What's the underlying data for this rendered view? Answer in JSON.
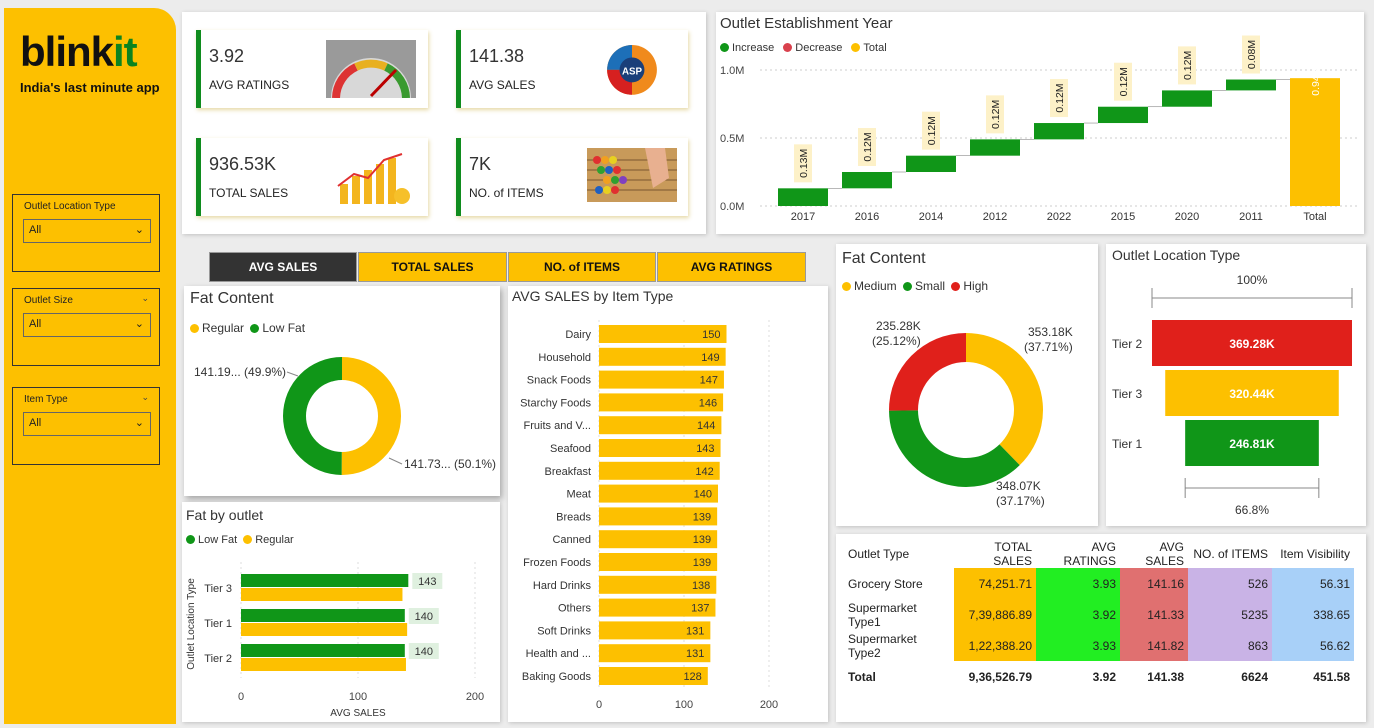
{
  "brand": {
    "name_main": "blink",
    "name_accent": "it",
    "tagline": "India's last minute app"
  },
  "slicers": [
    {
      "label": "Outlet Location Type",
      "value": "All"
    },
    {
      "label": "Outlet Size",
      "value": "All"
    },
    {
      "label": "Item Type",
      "value": "All"
    }
  ],
  "kpis": [
    {
      "value": "3.92",
      "label": "AVG RATINGS",
      "icon": "rating-gauge-image"
    },
    {
      "value": "141.38",
      "label": "AVG SALES",
      "icon": "asp-image"
    },
    {
      "value": "936.53K",
      "label": "TOTAL SALES",
      "icon": "coins-chart-image"
    },
    {
      "value": "7K",
      "label": "NO. of ITEMS",
      "icon": "abacus-image"
    }
  ],
  "tabs": [
    "AVG SALES",
    "TOTAL SALES",
    "NO. of ITEMS",
    "AVG RATINGS"
  ],
  "colors": {
    "yellow": "#fdc000",
    "green": "#109618",
    "red": "#e0201b",
    "dark": "#333333"
  },
  "waterfall": {
    "title": "Outlet Establishment Year",
    "legend": [
      "Increase",
      "Decrease",
      "Total"
    ],
    "y_ticks": [
      "1.0M",
      "0.5M",
      "0.0M"
    ]
  },
  "fat_content_small": {
    "title": "Fat Content",
    "legend": [
      "Regular",
      "Low Fat"
    ],
    "labels": [
      "141.19... (49.9%)",
      "141.73... (50.1%)"
    ]
  },
  "fat_by_outlet": {
    "title": "Fat by outlet",
    "legend": [
      "Low Fat",
      "Regular"
    ],
    "y_axis_title": "Outlet Location Type",
    "x_axis_title": "AVG SALES",
    "x_ticks": [
      "0",
      "100",
      "200"
    ]
  },
  "item_type": {
    "title": "AVG SALES by Item Type",
    "x_ticks": [
      "0",
      "100",
      "200"
    ]
  },
  "fat_content_large": {
    "title": "Fat Content",
    "legend": [
      "Medium",
      "Small",
      "High"
    ],
    "labels": {
      "high": [
        "235.28K",
        "(25.12%)"
      ],
      "medium": [
        "353.18K",
        "(37.71%)"
      ],
      "small": [
        "348.07K",
        "(37.17%)"
      ]
    }
  },
  "outlet_location": {
    "title": "Outlet Location Type",
    "top_pct": "100%",
    "bottom_pct": "66.8%"
  },
  "outlet_table": {
    "headers": [
      "Outlet Type",
      "TOTAL SALES",
      "AVG RATINGS",
      "AVG SALES",
      "NO. of ITEMS",
      "Item Visibility"
    ],
    "rows": [
      [
        "Grocery Store",
        "74,251.71",
        "3.93",
        "141.16",
        "526",
        "56.31"
      ],
      [
        "Supermarket Type1",
        "7,39,886.89",
        "3.92",
        "141.33",
        "5235",
        "338.65"
      ],
      [
        "Supermarket Type2",
        "1,22,388.20",
        "3.93",
        "141.82",
        "863",
        "56.62"
      ]
    ],
    "total": [
      "Total",
      "9,36,526.79",
      "3.92",
      "141.38",
      "6624",
      "451.58"
    ]
  },
  "chart_data": [
    {
      "type": "bar",
      "title": "Outlet Establishment Year",
      "subtype": "waterfall",
      "categories": [
        "2017",
        "2016",
        "2014",
        "2012",
        "2022",
        "2015",
        "2020",
        "2011",
        "Total"
      ],
      "values": [
        0.13,
        0.12,
        0.12,
        0.12,
        0.12,
        0.12,
        0.12,
        0.08,
        0.94
      ],
      "value_labels": [
        "0.13M",
        "0.12M",
        "0.12M",
        "0.12M",
        "0.12M",
        "0.12M",
        "0.12M",
        "0.08M",
        "0.94M"
      ],
      "ylim": [
        0,
        1.0
      ],
      "y_unit": "M"
    },
    {
      "type": "pie",
      "title": "Fat Content",
      "categories": [
        "Regular",
        "Low Fat"
      ],
      "values": [
        141.73,
        141.19
      ],
      "percent": [
        50.1,
        49.9
      ]
    },
    {
      "type": "bar",
      "title": "AVG SALES by Item Type",
      "orientation": "horizontal",
      "categories": [
        "Dairy",
        "Household",
        "Snack Foods",
        "Starchy Foods",
        "Fruits and V...",
        "Seafood",
        "Breakfast",
        "Meat",
        "Breads",
        "Canned",
        "Frozen Foods",
        "Hard Drinks",
        "Others",
        "Soft Drinks",
        "Health and ...",
        "Baking Goods"
      ],
      "values": [
        150,
        149,
        147,
        146,
        144,
        143,
        142,
        140,
        139,
        139,
        139,
        138,
        137,
        131,
        131,
        128
      ],
      "xlim": [
        0,
        200
      ]
    },
    {
      "type": "bar",
      "title": "Fat by outlet",
      "orientation": "horizontal",
      "categories": [
        "Tier 3",
        "Tier 1",
        "Tier 2"
      ],
      "series": [
        {
          "name": "Low Fat",
          "values": [
            143,
            140,
            140
          ]
        },
        {
          "name": "Regular",
          "values": [
            138,
            142,
            141
          ]
        }
      ],
      "xlabel": "AVG SALES",
      "ylabel": "Outlet Location Type",
      "xlim": [
        0,
        200
      ]
    },
    {
      "type": "pie",
      "title": "Fat Content",
      "categories": [
        "Medium",
        "Small",
        "High"
      ],
      "values": [
        353.18,
        348.07,
        235.28
      ],
      "percent": [
        37.71,
        37.17,
        25.12
      ]
    },
    {
      "type": "bar",
      "title": "Outlet Location Type",
      "subtype": "funnel",
      "categories": [
        "Tier 2",
        "Tier 3",
        "Tier 1"
      ],
      "values": [
        369.28,
        320.44,
        246.81
      ],
      "value_labels": [
        "369.28K",
        "320.44K",
        "246.81K"
      ]
    }
  ]
}
